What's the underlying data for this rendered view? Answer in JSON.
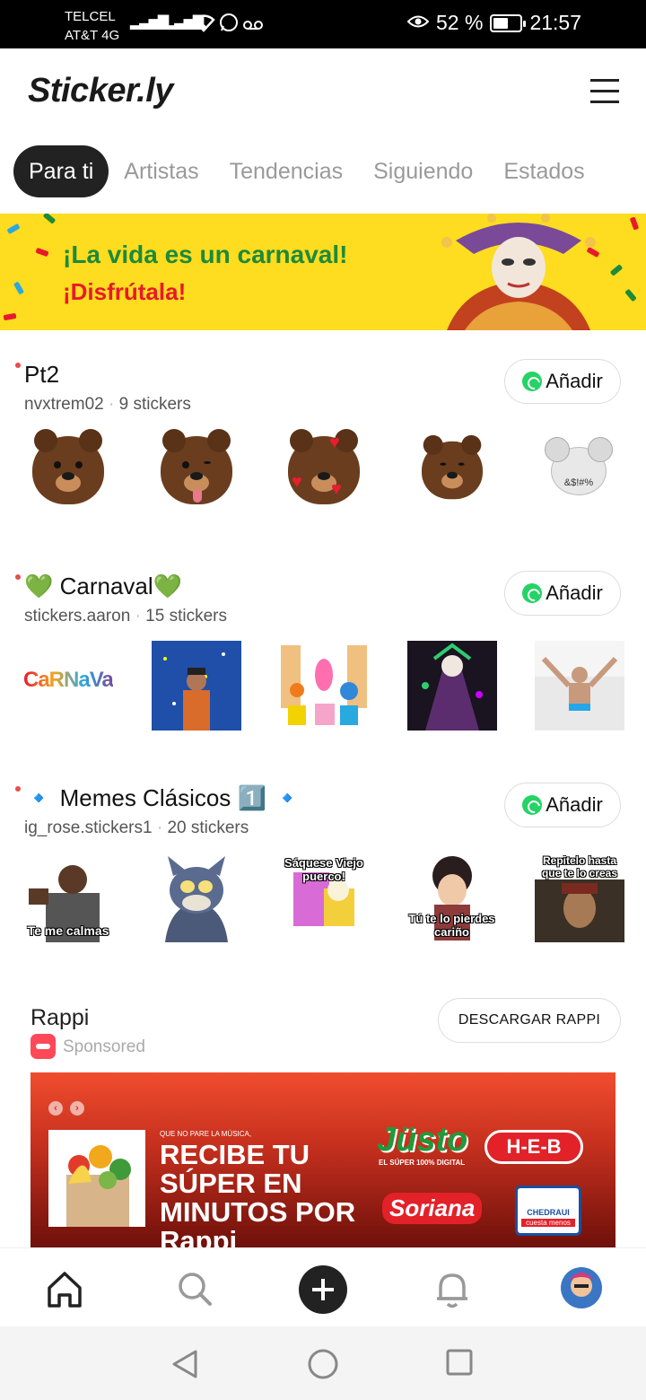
{
  "status_bar": {
    "carrier1": "TELCEL",
    "carrier2": "AT&T 4G",
    "battery": "52 %",
    "time": "21:57"
  },
  "header": {
    "logo": "Sticker.ly",
    "menu_icon": "hamburger-menu-icon"
  },
  "tabs": [
    {
      "label": "Para ti",
      "active": true
    },
    {
      "label": "Artistas"
    },
    {
      "label": "Tendencias"
    },
    {
      "label": "Siguiendo"
    },
    {
      "label": "Estados"
    }
  ],
  "banner": {
    "line1": "¡La vida es un carnaval!",
    "line2": "¡Disfrútala!"
  },
  "packs": [
    {
      "title": "Pt2",
      "author": "nvxtrem02",
      "count": "9 stickers",
      "add_label": "Añadir",
      "stickers": [
        "sad-bear",
        "winking-bear",
        "heart-eyes-bear",
        "angry-bear",
        "grumpy-mouse"
      ],
      "mouse_caption": "&$!#%"
    },
    {
      "title": "💚 Carnaval💚",
      "author": "stickers.aaron",
      "count": "15 stickers",
      "add_label": "Añadir",
      "stickers": [
        "carnaval-text",
        "confetti-man",
        "pocoyo-characters",
        "carnival-costume",
        "dancing-man"
      ],
      "carnaval_text": "CaRNaVaL"
    },
    {
      "title": "🔹 Memes Clásicos 1️⃣ 🔹",
      "author": "ig_rose.stickers1",
      "count": "20 stickers",
      "add_label": "Añadir",
      "captions": [
        "Te me calmas",
        "",
        "Sáquese Viejo puerco!",
        "Tú te lo pierdes cariño",
        "Repitelo hasta que te lo creas"
      ]
    }
  ],
  "ad": {
    "advertiser": "Rappi",
    "sponsored": "Sponsored",
    "cta": "DESCARGAR RAPPI",
    "small_text": "QUE NO PARE LA MÚSICA,",
    "headline": "RECIBE TU SÚPER EN MINUTOS POR Rappi",
    "brands": [
      "Jüsto",
      "H-E-B",
      "Soriana",
      "CHEDRAUI"
    ],
    "justo_tag": "EL SÚPER 100% DIGITAL",
    "chedraui_tag": "cuesta menos",
    "colors": {
      "accent": "#f04d2e",
      "dark": "#6a0f0a"
    }
  },
  "bottom_nav": [
    "home-icon",
    "search-icon",
    "add-icon",
    "bell-icon",
    "profile-avatar"
  ]
}
